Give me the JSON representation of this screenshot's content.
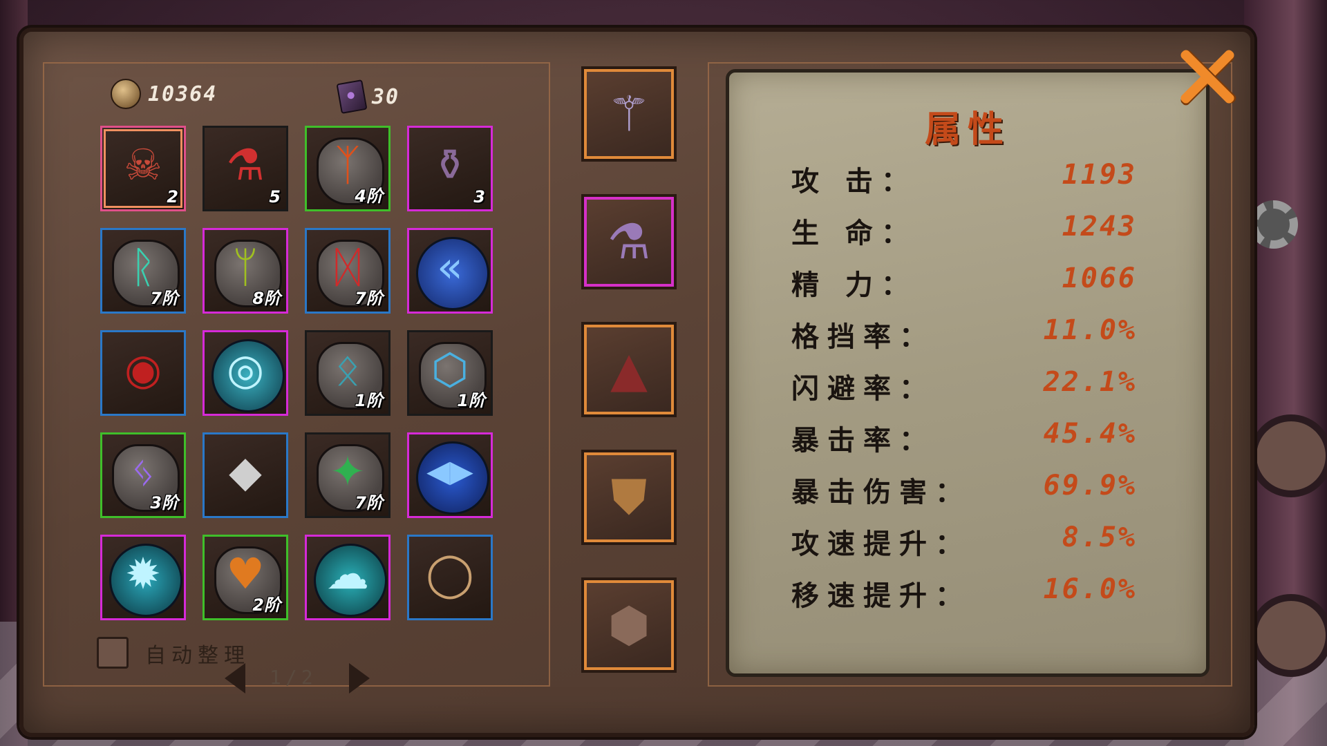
{
  "currency": {
    "gold": "10364",
    "gold_icon": "coin-icon",
    "gems": "30",
    "gems_icon": "spellbook-icon"
  },
  "inventory": {
    "slots": [
      {
        "name": "banner-mask-item",
        "icon": "mask-banner-icon",
        "badge": "2",
        "border": "selected"
      },
      {
        "name": "red-potion-item",
        "icon": "red-potion-icon",
        "badge": "5",
        "border": "black"
      },
      {
        "name": "fang-rune-item",
        "icon": "fang-rune-icon",
        "badge": "4阶",
        "border": "green"
      },
      {
        "name": "purple-jar-item",
        "icon": "purple-jar-icon",
        "badge": "3",
        "border": "magenta"
      },
      {
        "name": "teal-sword-rune-item",
        "icon": "teal-sword-rune-icon",
        "badge": "7阶",
        "border": "blue"
      },
      {
        "name": "tree-rune-item",
        "icon": "tree-rune-icon",
        "badge": "8阶",
        "border": "magenta"
      },
      {
        "name": "flame-rune-item",
        "icon": "flame-rune-icon",
        "badge": "7阶",
        "border": "blue"
      },
      {
        "name": "blue-chevron-orb-item",
        "icon": "chevron-orb-icon",
        "badge": "",
        "border": "magenta"
      },
      {
        "name": "dark-eye-item",
        "icon": "dark-eye-icon",
        "badge": "",
        "border": "blue"
      },
      {
        "name": "cyan-eye-orb-item",
        "icon": "eye-orb-icon",
        "badge": "",
        "border": "magenta"
      },
      {
        "name": "cat-rune-item",
        "icon": "cat-rune-icon",
        "badge": "1阶",
        "border": "black"
      },
      {
        "name": "shield-rune-item",
        "icon": "shield-rune-icon",
        "badge": "1阶",
        "border": "black"
      },
      {
        "name": "bird-rune-item",
        "icon": "bird-rune-icon",
        "badge": "3阶",
        "border": "green"
      },
      {
        "name": "crystal-shard-item",
        "icon": "crystal-shard-icon",
        "badge": "",
        "border": "blue"
      },
      {
        "name": "green-blade-rune-item",
        "icon": "blade-rune-icon",
        "badge": "7阶",
        "border": "black"
      },
      {
        "name": "blue-arrow-orb-item",
        "icon": "arrow-orb-icon",
        "badge": "",
        "border": "magenta"
      },
      {
        "name": "sun-orb-item",
        "icon": "sun-orb-icon",
        "badge": "",
        "border": "magenta"
      },
      {
        "name": "heart-rune-item",
        "icon": "heart-rune-icon",
        "badge": "2阶",
        "border": "green"
      },
      {
        "name": "cloud-orb-item",
        "icon": "cloud-orb-icon",
        "badge": "",
        "border": "magenta"
      },
      {
        "name": "flame-ring-item",
        "icon": "ring-icon",
        "badge": "",
        "border": "blue"
      }
    ],
    "auto_sort_label": "自动整理",
    "page": "1/2"
  },
  "equipment": [
    {
      "name": "weapon-slot",
      "icon": "staff-icon",
      "border": "orange"
    },
    {
      "name": "accessory-slot",
      "icon": "flask-icon",
      "border": "magenta"
    },
    {
      "name": "helmet-slot",
      "icon": "hood-icon",
      "border": "orange"
    },
    {
      "name": "armor-slot",
      "icon": "armor-icon",
      "border": "orange"
    },
    {
      "name": "boots-slot",
      "icon": "boots-icon",
      "border": "orange"
    }
  ],
  "attributes": {
    "title": "属性",
    "rows": [
      {
        "label": "攻 击：",
        "value": "1193"
      },
      {
        "label": "生 命：",
        "value": "1243"
      },
      {
        "label": "精 力：",
        "value": "1066"
      },
      {
        "label": "格挡率：",
        "value": "11.0%"
      },
      {
        "label": "闪避率：",
        "value": "22.1%"
      },
      {
        "label": "暴击率：",
        "value": "45.4%"
      },
      {
        "label": "暴击伤害：",
        "value": "69.9%"
      },
      {
        "label": "攻速提升：",
        "value": "8.5%"
      },
      {
        "label": "移速提升：",
        "value": "16.0%"
      }
    ]
  },
  "colors": {
    "accent_orange": "#f08a2a",
    "value_red": "#c44a1a",
    "rarity_green": "#3fbf2a",
    "rarity_magenta": "#d62ad8",
    "rarity_blue": "#2a78c8"
  }
}
